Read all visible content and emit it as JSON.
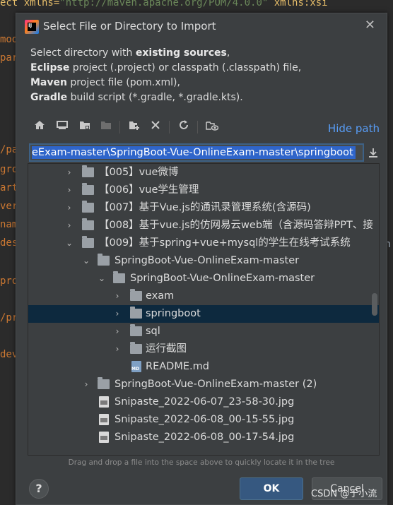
{
  "editor": {
    "top_line_left": "ect xmlns=",
    "top_line_str": "\"http://maven.apache.org/POM/4.0.0\"",
    "top_line_right": " xmlns:xsi",
    "left_fragments": [
      "mod",
      "par",
      "/pa",
      "gro",
      "art",
      "ver",
      "nam",
      "des",
      "pro",
      "/pr",
      "dev"
    ],
    "right_fragments": [
      "in",
      "c",
      "c",
      "c",
      "c"
    ]
  },
  "dialog": {
    "title": "Select File or Directory to Import",
    "close_icon": "close-icon",
    "description": {
      "line1_pre": "Select directory with ",
      "line1_bold": "existing sources",
      "line1_post": ",",
      "line2_bold": "Eclipse",
      "line2_post": " project (.project) or classpath (.classpath) file,",
      "line3_bold": "Maven",
      "line3_post": " project file (pom.xml),",
      "line4_bold": "Gradle",
      "line4_post": " build script (*.gradle, *.gradle.kts)."
    },
    "toolbar": {
      "home": "⌂",
      "desktop": "▭",
      "project": "▣",
      "module": "▣",
      "new_folder": "▣",
      "delete": "✕",
      "refresh": "⟳",
      "show_hidden": "◉"
    },
    "hide_path_label": "Hide path",
    "path_value": "eExam-master\\SpringBoot-Vue-OnlineExam-master\\springboot",
    "tree": [
      {
        "arrow": "›",
        "icon": "folder",
        "label": "【005】vue微博"
      },
      {
        "arrow": "›",
        "icon": "folder",
        "label": "【006】vue学生管理"
      },
      {
        "arrow": "›",
        "icon": "folder",
        "label": "【007】基于Vue.js的通讯录管理系统(含源码)"
      },
      {
        "arrow": "›",
        "icon": "folder",
        "label": "【008】基于vue.js的仿网易云web端（含源码答辩PPT、接"
      },
      {
        "arrow": "⌄",
        "icon": "folder",
        "label": "【009】基于spring+vue+mysql的学生在线考试系统"
      },
      {
        "arrow": "⌄",
        "icon": "folder",
        "label": "SpringBoot-Vue-OnlineExam-master"
      },
      {
        "arrow": "⌄",
        "icon": "folder",
        "label": "SpringBoot-Vue-OnlineExam-master"
      },
      {
        "arrow": "›",
        "icon": "folder",
        "label": "exam"
      },
      {
        "arrow": "›",
        "icon": "folder",
        "label": "springboot"
      },
      {
        "arrow": "›",
        "icon": "folder",
        "label": "sql"
      },
      {
        "arrow": "›",
        "icon": "folder",
        "label": "运行截图"
      },
      {
        "arrow": "",
        "icon": "markdown",
        "label": "README.md"
      },
      {
        "arrow": "›",
        "icon": "folder",
        "label": "SpringBoot-Vue-OnlineExam-master (2)"
      },
      {
        "arrow": "",
        "icon": "image",
        "label": "Snipaste_2022-06-07_23-58-30.jpg"
      },
      {
        "arrow": "",
        "icon": "image",
        "label": "Snipaste_2022-06-08_00-15-55.jpg"
      },
      {
        "arrow": "",
        "icon": "image",
        "label": "Snipaste_2022-06-08_00-17-54.jpg"
      }
    ],
    "hint": "Drag and drop a file into the space above to quickly locate it in the tree",
    "help_label": "?",
    "ok_label": "OK",
    "cancel_label": "Cancel"
  },
  "watermark": "CSDN @于小流"
}
